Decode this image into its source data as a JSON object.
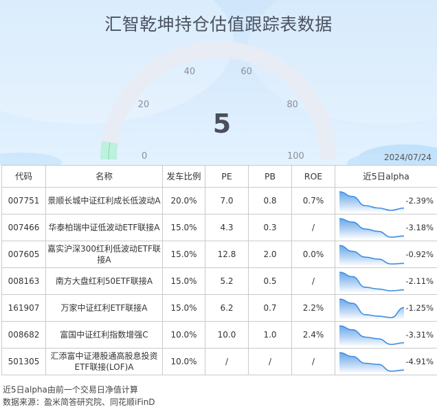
{
  "title": "汇智乾坤持仓估值跟踪表数据",
  "gauge": {
    "value": "5",
    "value_num": 5,
    "min": 0,
    "max": 100,
    "ticks": [
      "0",
      "20",
      "40",
      "60",
      "80",
      "100"
    ]
  },
  "date": "2024/07/24",
  "table": {
    "headers": [
      "代码",
      "名称",
      "发车比例",
      "PE",
      "PB",
      "ROE",
      "近5日alpha"
    ],
    "rows": [
      {
        "code": "007751",
        "name": "景顺长城中证红利成长低波动A",
        "ratio": "20.0%",
        "pe": "7.0",
        "pb": "0.8",
        "roe": "0.7%",
        "alpha": "-2.39%",
        "spark": [
          0.0,
          -0.6,
          -1.8,
          -2.1,
          -2.4,
          -2.1
        ]
      },
      {
        "code": "007466",
        "name": "华泰柏瑞中证低波动ETF联接A",
        "ratio": "15.0%",
        "pe": "4.3",
        "pb": "0.3",
        "roe": "/",
        "alpha": "-3.18%",
        "spark": [
          0.0,
          -0.6,
          -1.8,
          -2.2,
          -3.2,
          -3.0
        ]
      },
      {
        "code": "007605",
        "name": "嘉实沪深300红利低波动ETF联接A",
        "ratio": "15.0%",
        "pe": "12.8",
        "pb": "2.0",
        "roe": "0.0%",
        "alpha": "-0.92%",
        "spark": [
          0.0,
          -0.3,
          -0.6,
          -0.7,
          -0.95,
          -0.92
        ]
      },
      {
        "code": "008163",
        "name": "南方大盘红利50ETF联接A",
        "ratio": "15.0%",
        "pe": "5.2",
        "pb": "0.5",
        "roe": "/",
        "alpha": "-2.11%",
        "spark": [
          0.0,
          -0.5,
          -1.7,
          -1.9,
          -2.1,
          -2.0
        ]
      },
      {
        "code": "161907",
        "name": "万家中证红利ETF联接A",
        "ratio": "15.0%",
        "pe": "6.2",
        "pb": "0.7",
        "roe": "2.2%",
        "alpha": "-1.25%",
        "spark": [
          0.0,
          -0.3,
          -1.1,
          -1.2,
          -1.3,
          -0.6
        ]
      },
      {
        "code": "008682",
        "name": "富国中证红利指数增强C",
        "ratio": "10.0%",
        "pe": "10.0",
        "pb": "1.0",
        "roe": "2.4%",
        "alpha": "-3.31%",
        "spark": [
          0.0,
          -0.7,
          -2.0,
          -2.3,
          -3.3,
          -3.0
        ]
      },
      {
        "code": "501305",
        "name": "汇添富中证港股通高股息投资ETF联接(LOF)A",
        "ratio": "10.0%",
        "pe": "/",
        "pb": "/",
        "roe": "/",
        "alpha": "-4.91%",
        "spark": [
          0.0,
          -1.0,
          -2.8,
          -3.1,
          -4.9,
          -4.6
        ]
      }
    ]
  },
  "footnotes": {
    "line1": "近5日alpha由前一个交易日净值计算",
    "line2": "数据来源：盈米简答研究院、同花顺iFinD"
  },
  "colors": {
    "accent": "#3d8de3",
    "gauge_track": "#e8ecf5",
    "gauge_fill": "#bdf0dd",
    "sparkline_fill_top": "#3d8de3",
    "sparkline_fill_bottom": "#ffffff"
  }
}
